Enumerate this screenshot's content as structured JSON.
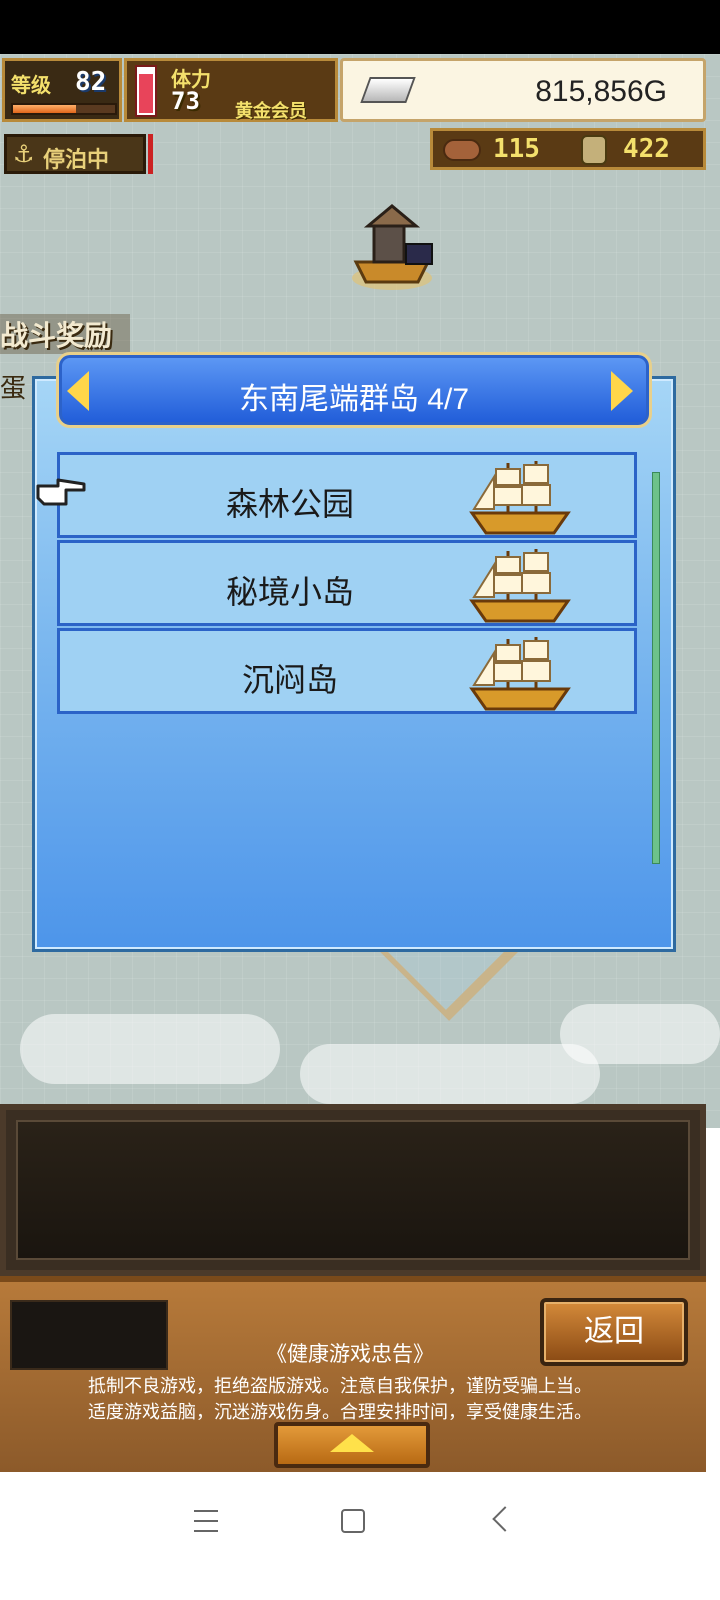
{
  "hud": {
    "level_label": "等级",
    "level_value": "82",
    "xp_fraction": 0.62,
    "stamina_label": "体力",
    "stamina_value": "73",
    "stamina_fraction": 0.9,
    "member_label": "黄金会员",
    "gold": "815,856G",
    "docked_label": "停泊中",
    "resource1": "115",
    "resource2": "422"
  },
  "map": {
    "battle_reward_label": "战斗奖励",
    "egg_label": "蛋"
  },
  "dialog": {
    "title": "东南尾端群岛 4/7",
    "items": [
      {
        "name": "森林公园"
      },
      {
        "name": "秘境小岛"
      },
      {
        "name": "沉闷岛"
      }
    ]
  },
  "bottom": {
    "back_label": "返回",
    "advice_title": "《健康游戏忠告》",
    "advice_line1": "抵制不良游戏，拒绝盗版游戏。注意自我保护，谨防受骗上当。",
    "advice_line2": "适度游戏益脑，沉迷游戏伤身。合理安排时间，享受健康生活。"
  },
  "colors": {
    "dialog_header": "#1f5bd8",
    "list_item": "#9fd1f3",
    "accent_gold": "#ffd64a"
  }
}
